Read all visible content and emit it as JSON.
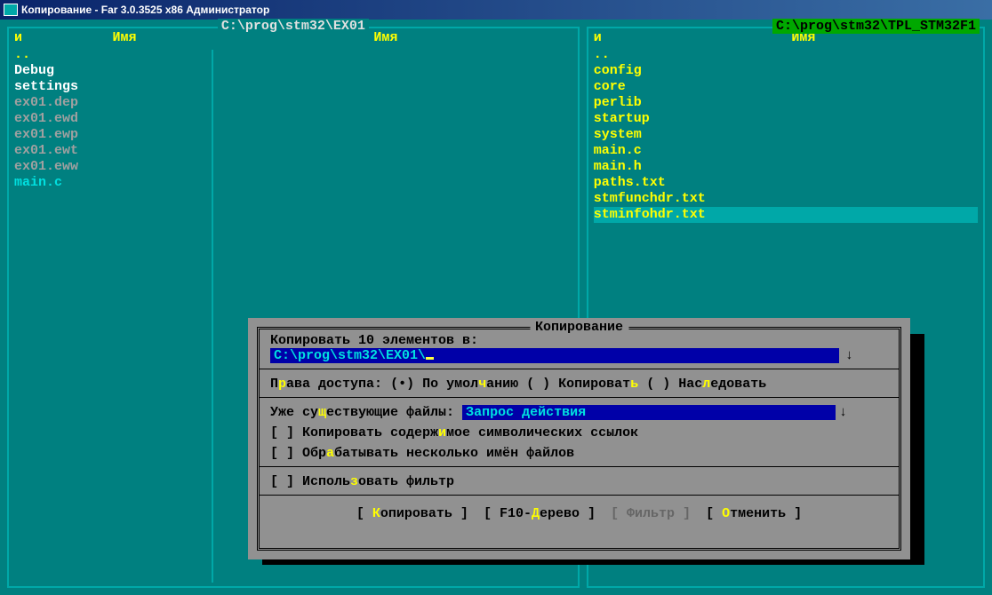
{
  "titlebar": "Копирование - Far 3.0.3525 x86 Администратор",
  "leftPanel": {
    "path": "C:\\prog\\stm32\\EX01",
    "hcol1": "и",
    "hcol2": "Имя",
    "hcol3": "Имя",
    "items": [
      {
        "name": "..",
        "cls": "clr-parent"
      },
      {
        "name": "Debug",
        "cls": "clr-folder"
      },
      {
        "name": "settings",
        "cls": "clr-folder"
      },
      {
        "name": "ex01.dep",
        "cls": "clr-grey"
      },
      {
        "name": "ex01.ewd",
        "cls": "clr-grey"
      },
      {
        "name": "ex01.ewp",
        "cls": "clr-grey"
      },
      {
        "name": "ex01.ewt",
        "cls": "clr-grey"
      },
      {
        "name": "ex01.eww",
        "cls": "clr-grey"
      },
      {
        "name": "main.c",
        "cls": "clr-cyan"
      }
    ]
  },
  "rightPanel": {
    "path": "C:\\prog\\stm32\\TPL_STM32F1",
    "hcol1": "и",
    "hcol2": "Имя",
    "items": [
      {
        "name": "..",
        "cls": "clr-yellow",
        "sel": false
      },
      {
        "name": "config",
        "cls": "clr-yellow",
        "sel": false
      },
      {
        "name": "core",
        "cls": "clr-yellow",
        "sel": false
      },
      {
        "name": "perlib",
        "cls": "clr-yellow",
        "sel": false
      },
      {
        "name": "startup",
        "cls": "clr-yellow",
        "sel": false
      },
      {
        "name": "system",
        "cls": "clr-yellow",
        "sel": false
      },
      {
        "name": "main.c",
        "cls": "clr-yellow",
        "sel": false
      },
      {
        "name": "main.h",
        "cls": "clr-yellow",
        "sel": false
      },
      {
        "name": "paths.txt",
        "cls": "clr-yellow",
        "sel": false
      },
      {
        "name": "stmfunchdr.txt",
        "cls": "clr-yellow",
        "sel": false
      },
      {
        "name": "stminfohdr.txt",
        "cls": "clr-yellow",
        "sel": true
      }
    ]
  },
  "dialog": {
    "title": "Копирование",
    "prompt": "Копировать 10 элементов в:",
    "dest": "C:\\prog\\stm32\\EX01\\",
    "rights_label_pre": "П",
    "rights_label_hot": "р",
    "rights_label_post": "ава доступа:",
    "opt_default_pre": "(•) По умол",
    "opt_default_hot": "ч",
    "opt_default_post": "анию",
    "opt_copy_pre": "( ) Копироват",
    "opt_copy_hot": "ь",
    "opt_copy_post": "",
    "opt_inherit_pre": "( ) Нас",
    "opt_inherit_hot": "л",
    "opt_inherit_post": "едовать",
    "existing_pre": "Уже су",
    "existing_hot": "щ",
    "existing_post": "ествующие файлы:",
    "existing_value": "Запрос действия",
    "chk_symlinks_pre": "[ ] Копировать содерж",
    "chk_symlinks_hot": "и",
    "chk_symlinks_post": "мое символических ссылок",
    "chk_multiname_pre": "[ ] Обр",
    "chk_multiname_hot": "а",
    "chk_multiname_post": "батывать несколько имён файлов",
    "chk_filter_pre": "[ ] Исполь",
    "chk_filter_hot": "з",
    "chk_filter_post": "овать фильтр",
    "btn_copy_pre": "[ ",
    "btn_copy_hot": "К",
    "btn_copy_post": "опировать ]",
    "btn_tree_pre": "[ F10-",
    "btn_tree_hot": "Д",
    "btn_tree_post": "ерево ]",
    "btn_filter": "[ Фильтр ]",
    "btn_cancel_pre": "[ ",
    "btn_cancel_hot": "О",
    "btn_cancel_post": "тменить ]"
  }
}
